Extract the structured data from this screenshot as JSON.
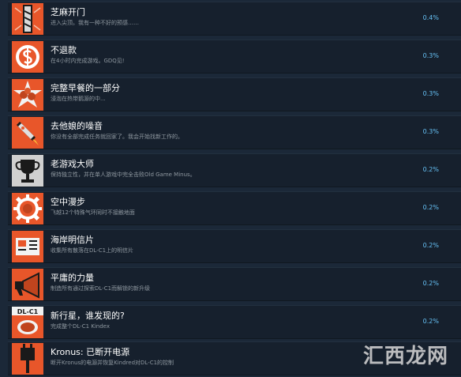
{
  "colors": {
    "background": "#1b2838",
    "row": "#16202d",
    "icon_bg": "#e8562a",
    "title": "#ffffff",
    "desc": "#8f98a0",
    "percent": "#66c0f4"
  },
  "achievements": [
    {
      "title": "芝麻开门",
      "desc": "进入尖顶。我有一种不好的预感……",
      "percent": "0.4%",
      "icon": "pillar-icon"
    },
    {
      "title": "不退款",
      "desc": "在4小时内完成游戏。GDQ见!",
      "percent": "0.3%",
      "icon": "dollar-icon"
    },
    {
      "title": "完整早餐的一部分",
      "desc": "浸泡在热带鹅源的中...",
      "percent": "0.3%",
      "icon": "breakfast-icon"
    },
    {
      "title": "去他娘的噪音",
      "desc": "你没有全部完成任务就回家了。我会开始找新工作的。",
      "percent": "0.3%",
      "icon": "rocket-icon"
    },
    {
      "title": "老游戏大师",
      "desc": "保持独立性，并在单人游戏中完全击败Old Game Minus。",
      "percent": "0.2%",
      "icon": "trophy-icon"
    },
    {
      "title": "空中漫步",
      "desc": "飞越12个特殊气环同时不接触地面",
      "percent": "0.2%",
      "icon": "gear-icon"
    },
    {
      "title": "海岸明信片",
      "desc": "收集所有散落在DL-C1上的明信片",
      "percent": "0.2%",
      "icon": "postcard-icon"
    },
    {
      "title": "平庸的力量",
      "desc": "制造所有通过探索DL-C1而解锁的新升级",
      "percent": "0.2%",
      "icon": "megaphone-icon"
    },
    {
      "title": "新行星，谁发现的?",
      "desc": "完成整个DL-C1 Kindex",
      "percent": "0.2%",
      "icon": "planet-icon",
      "icon_text": "DL-C1"
    },
    {
      "title": "Kronus: 已断开电源",
      "desc": "断开Kronus的电源并恢复Kindred对DL-C1的控制",
      "percent": "",
      "icon": "plug-icon"
    }
  ],
  "watermark": "汇西龙网"
}
